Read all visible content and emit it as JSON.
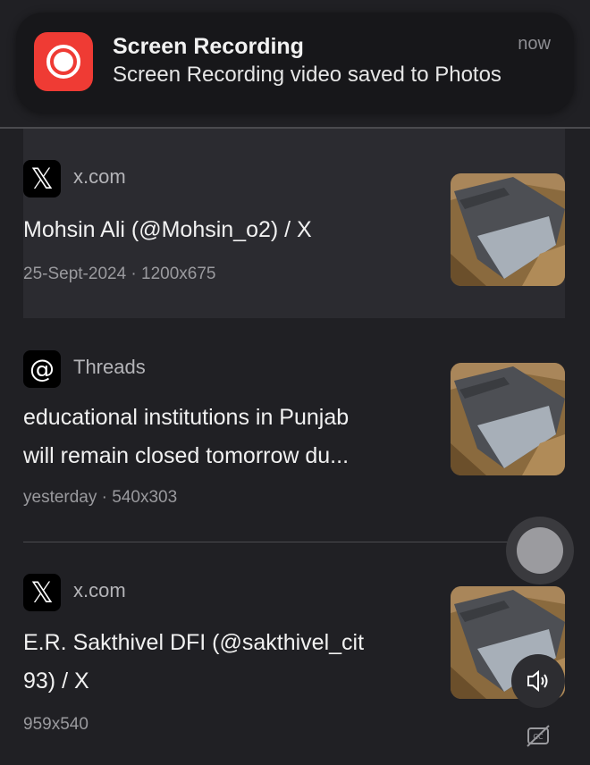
{
  "notification": {
    "icon": "screen-recording-icon",
    "title": "Screen Recording",
    "body": "Screen Recording video saved to Photos",
    "time": "now",
    "accent": "#ef3b34"
  },
  "results": [
    {
      "site_icon": "x-logo-icon",
      "site_glyph": "𝕏",
      "site": "x.com",
      "title": "Mohsin Ali (@Mohsin_o2) / X",
      "meta": "25-Sept-2024 · 1200x675",
      "selected": true
    },
    {
      "site_icon": "threads-logo-icon",
      "site_glyph": "@",
      "site": "Threads",
      "title_line1": "educational institutions in Punjab",
      "title_line2": "will remain closed tomorrow du...",
      "meta": "yesterday · 540x303"
    },
    {
      "site_icon": "x-logo-icon",
      "site_glyph": "𝕏",
      "site": "x.com",
      "title_line1": "E.R. Sakthivel DFI (@sakthivel_cit",
      "title_line2": "93) / X",
      "meta": "959x540"
    }
  ],
  "controls": {
    "floating": "assistive-touch-button",
    "volume": "speaker-icon",
    "captions": "captions-off-icon"
  }
}
